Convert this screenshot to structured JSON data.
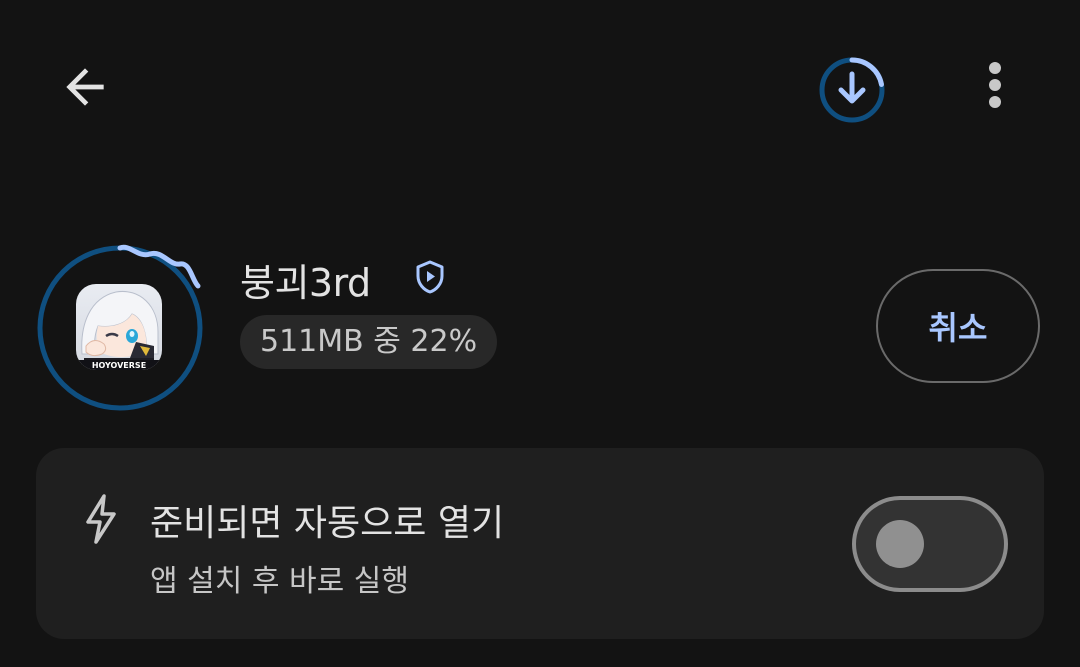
{
  "topbar": {
    "back_icon": "arrow-back-icon",
    "download_icon": "download-progress-icon",
    "more_icon": "more-vert-icon"
  },
  "app": {
    "title": "붕괴3rd",
    "icon_text": "HOYOVERSE",
    "status": "511MB 중 22%",
    "progress": 0.22,
    "verified_icon": "play-protect-badge-icon"
  },
  "actions": {
    "cancel_label": "취소"
  },
  "auto_open": {
    "icon": "flash-icon",
    "title": "준비되면 자동으로 열기",
    "subtitle": "앱 설치 후 바로 실행",
    "enabled": false
  },
  "colors": {
    "background": "#131313",
    "card": "#1f1f1f",
    "accent": "#a9c7ff",
    "progress_track": "#0f4f80",
    "progress_fill": "#a9c7ff"
  }
}
